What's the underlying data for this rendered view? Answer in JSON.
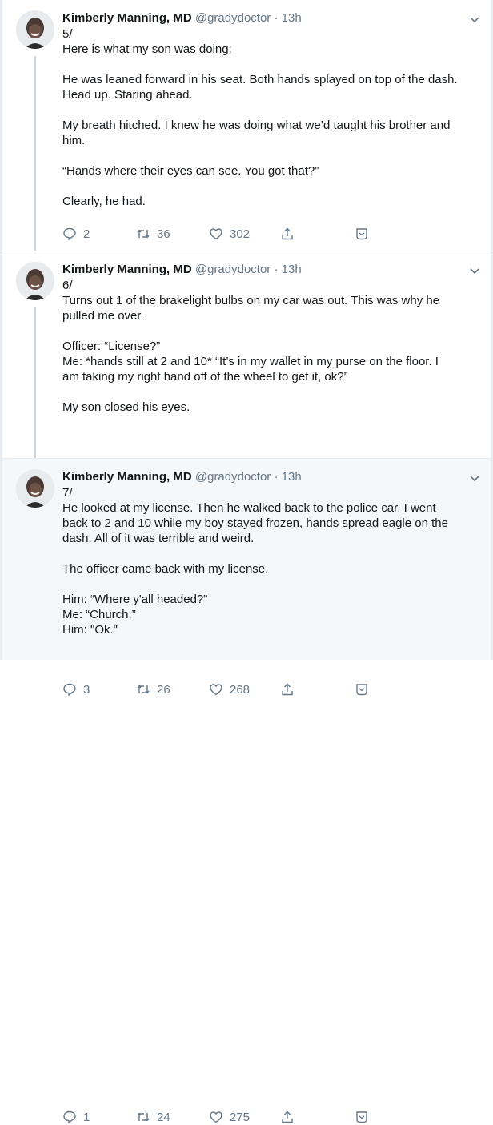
{
  "tweets": [
    {
      "author": "Kimberly Manning, MD",
      "handle": "@gradydoctor",
      "separator": "·",
      "time": "13h",
      "lines": [
        "5/",
        "Here is what my son was doing:",
        "",
        "He was leaned forward in his seat. Both hands splayed on top of the dash.",
        "Head up. Staring ahead.",
        "",
        "My breath hitched. I knew he was doing what we’d taught his brother and",
        "him.",
        "",
        "“Hands where their eyes can see. You got that?”",
        "",
        "Clearly, he had."
      ],
      "replies": "2",
      "retweets": "36",
      "likes": "302"
    },
    {
      "author": "Kimberly Manning, MD",
      "handle": "@gradydoctor",
      "separator": "·",
      "time": "13h",
      "lines": [
        "6/",
        "Turns out 1 of the brakelight bulbs on my car was out. This was why he",
        "pulled me over.",
        "",
        "Officer: “License?”",
        "Me: *hands still at 2 and 10* “It’s in my wallet in my purse on the floor. I",
        "am taking my right hand off of the wheel to get it, ok?”",
        "",
        "My son closed his eyes."
      ],
      "replies": "3",
      "retweets": "26",
      "likes": "268"
    },
    {
      "author": "Kimberly Manning, MD",
      "handle": "@gradydoctor",
      "separator": "·",
      "time": "13h",
      "lines": [
        "7/",
        "He looked at my license. Then he walked back to the police car. I went",
        "back to 2 and 10 while my boy stayed frozen, hands spread eagle on the",
        "dash. All of it was terrible and weird.",
        "",
        "The officer came back with my license.",
        "",
        "Him: “Where y'all headed?”",
        "Me: “Church.”",
        "Him: \"Ok.\""
      ],
      "replies": "1",
      "retweets": "24",
      "likes": "275"
    }
  ],
  "icons": {
    "reply": "reply-icon",
    "retweet": "retweet-icon",
    "like": "heart-icon",
    "share": "share-icon",
    "bookmark": "bookmark-icon",
    "more": "chevron-down-icon",
    "avatar": "avatar"
  },
  "colors": {
    "text": "#14171a",
    "secondary": "#657786",
    "thread_line": "#ccd6dd",
    "highlight_bg": "#f5f8fa",
    "border": "#e6ecf0"
  }
}
